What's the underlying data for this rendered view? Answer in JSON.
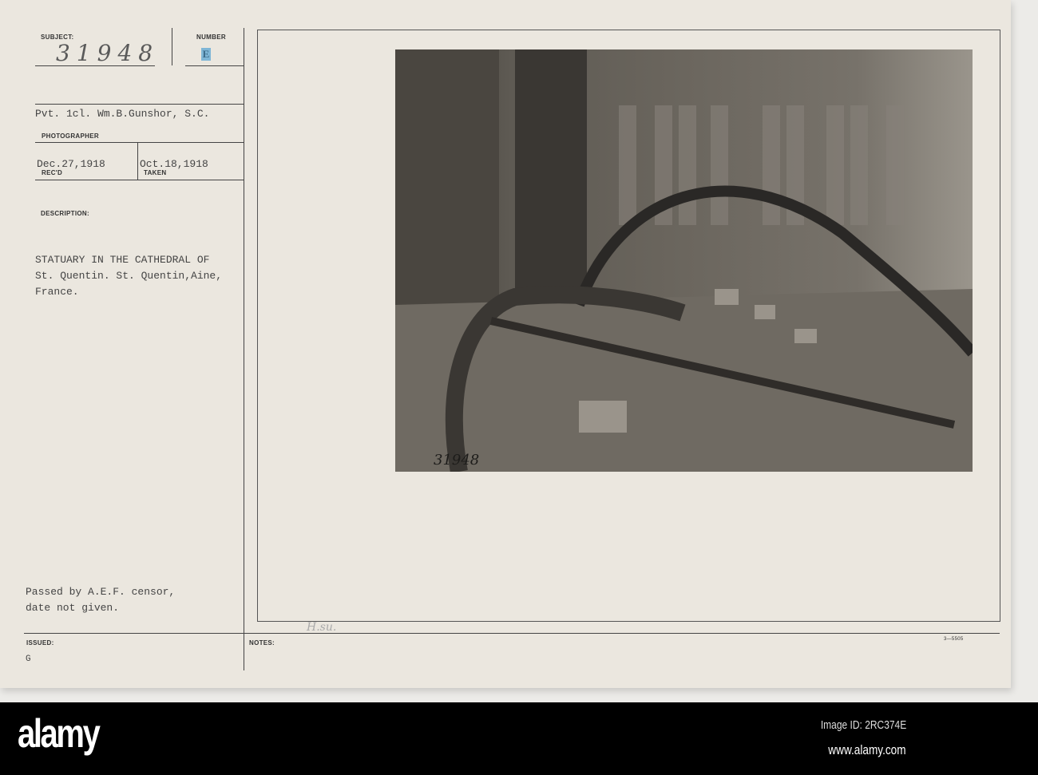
{
  "card": {
    "subject_label": "SUBJECT:",
    "subject_value": "31948",
    "number_label": "NUMBER",
    "number_value": "E",
    "photographer_value": "Pvt. 1cl. Wm.B.Gunshor, S.C.",
    "photographer_label": "PHOTOGRAPHER",
    "received_value": "Dec.27,1918",
    "received_label": "REC'D",
    "taken_value": "Oct.18,1918",
    "taken_label": "TAKEN",
    "description_label": "DESCRIPTION:",
    "description_lines": [
      "STATUARY IN THE CATHEDRAL OF",
      "St. Quentin. St. Quentin,Aine,",
      "France."
    ],
    "censor_lines": [
      "Passed by A.E.F. censor,",
      "date not given."
    ],
    "issued_label": "ISSUED:",
    "issued_value": "G",
    "notes_label": "NOTES:",
    "notes_handwriting": "H.su.",
    "form_number": "3—5505",
    "photo_inscription": "31948"
  },
  "footer": {
    "logo": "alamy",
    "image_id": "Image ID: 2RC374E",
    "url": "www.alamy.com"
  },
  "colors": {
    "number_stamp": "#7fb6d6"
  }
}
